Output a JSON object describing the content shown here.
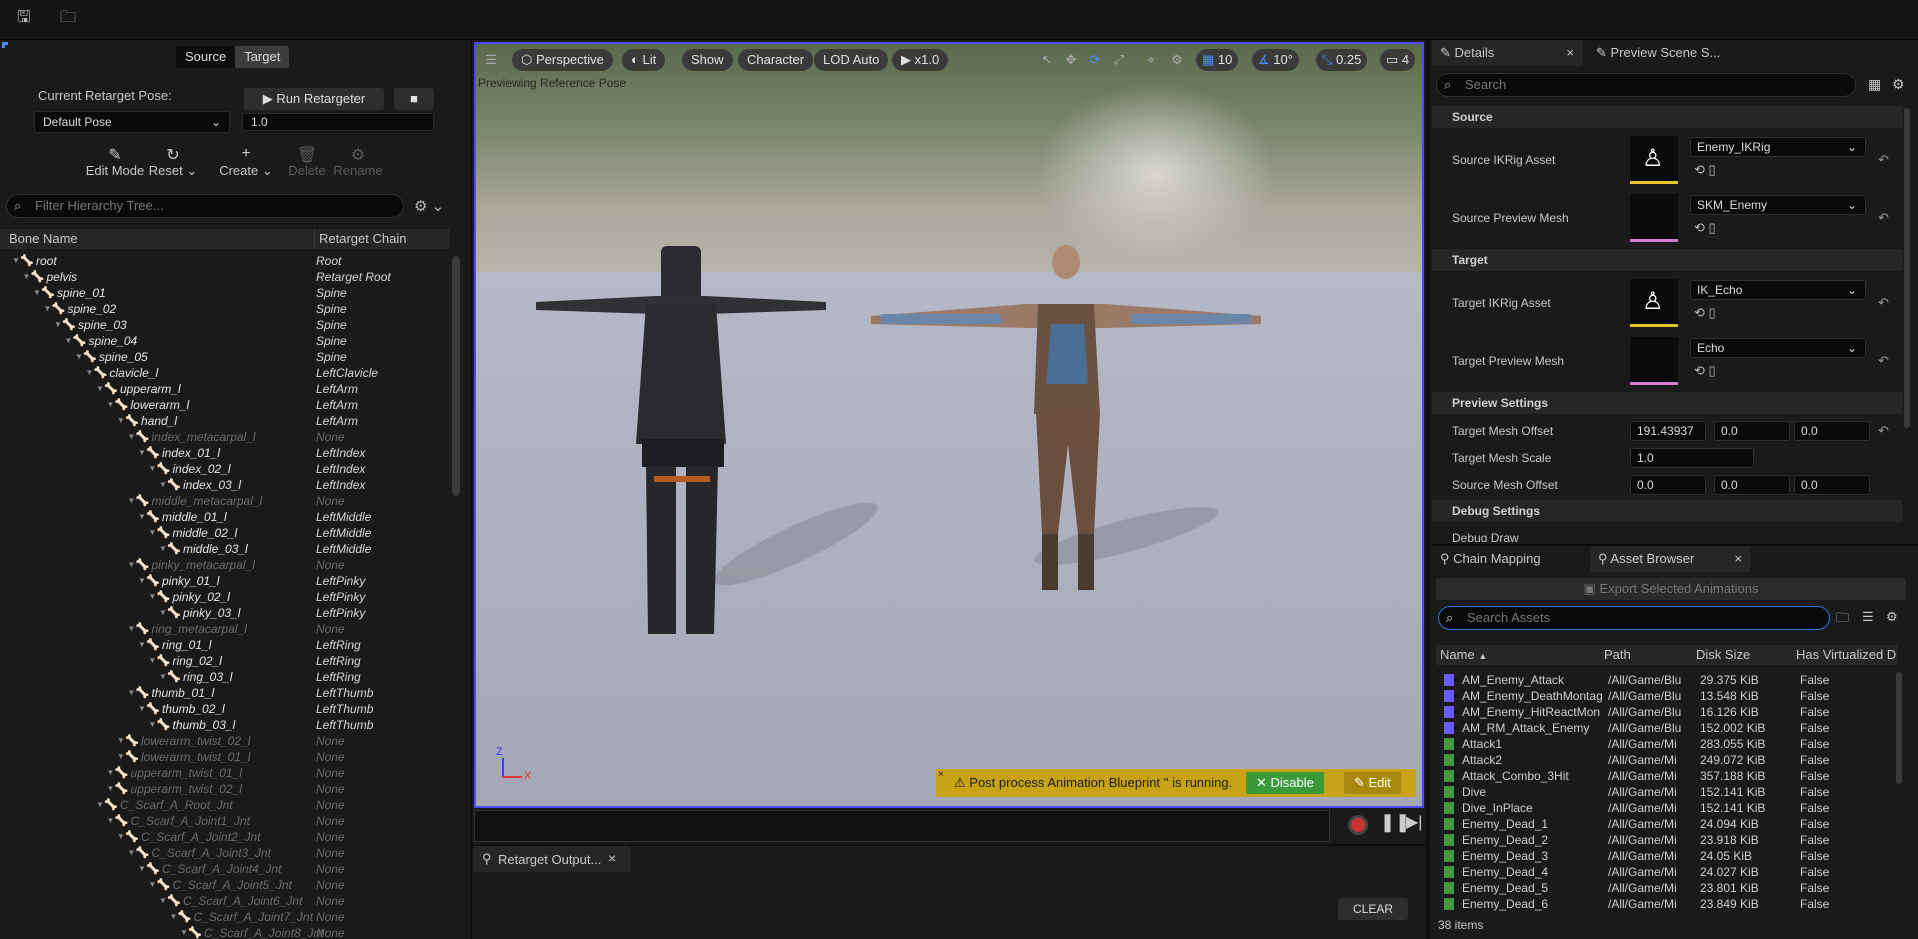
{
  "toolbar": {
    "save_icon": "save-icon",
    "open_icon": "open-asset-icon"
  },
  "left_panel": {
    "source_tab": "Source",
    "target_tab": "Target",
    "current_pose_label": "Current Retarget Pose:",
    "run_button": "Run Retargeter",
    "pose_value": "Default Pose",
    "pose_blend": "1.0",
    "tools": {
      "edit_mode": "Edit Mode",
      "reset": "Reset",
      "create": "Create",
      "delete": "Delete",
      "rename": "Rename"
    },
    "filter_placeholder": "Filter Hierarchy Tree...",
    "col_bone": "Bone Name",
    "col_chain": "Retarget Chain",
    "bones": [
      {
        "name": "root",
        "chain": "Root",
        "depth": 0,
        "dim": false
      },
      {
        "name": "pelvis",
        "chain": "Retarget Root",
        "depth": 1,
        "dim": false
      },
      {
        "name": "spine_01",
        "chain": "Spine",
        "depth": 2,
        "dim": false
      },
      {
        "name": "spine_02",
        "chain": "Spine",
        "depth": 3,
        "dim": false
      },
      {
        "name": "spine_03",
        "chain": "Spine",
        "depth": 4,
        "dim": false
      },
      {
        "name": "spine_04",
        "chain": "Spine",
        "depth": 5,
        "dim": false
      },
      {
        "name": "spine_05",
        "chain": "Spine",
        "depth": 6,
        "dim": false
      },
      {
        "name": "clavicle_l",
        "chain": "LeftClavicle",
        "depth": 7,
        "dim": false
      },
      {
        "name": "upperarm_l",
        "chain": "LeftArm",
        "depth": 8,
        "dim": false
      },
      {
        "name": "lowerarm_l",
        "chain": "LeftArm",
        "depth": 9,
        "dim": false
      },
      {
        "name": "hand_l",
        "chain": "LeftArm",
        "depth": 10,
        "dim": false
      },
      {
        "name": "index_metacarpal_l",
        "chain": "None",
        "depth": 11,
        "dim": true
      },
      {
        "name": "index_01_l",
        "chain": "LeftIndex",
        "depth": 12,
        "dim": false
      },
      {
        "name": "index_02_l",
        "chain": "LeftIndex",
        "depth": 13,
        "dim": false
      },
      {
        "name": "index_03_l",
        "chain": "LeftIndex",
        "depth": 14,
        "dim": false
      },
      {
        "name": "middle_metacarpal_l",
        "chain": "None",
        "depth": 11,
        "dim": true
      },
      {
        "name": "middle_01_l",
        "chain": "LeftMiddle",
        "depth": 12,
        "dim": false
      },
      {
        "name": "middle_02_l",
        "chain": "LeftMiddle",
        "depth": 13,
        "dim": false
      },
      {
        "name": "middle_03_l",
        "chain": "LeftMiddle",
        "depth": 14,
        "dim": false
      },
      {
        "name": "pinky_metacarpal_l",
        "chain": "None",
        "depth": 11,
        "dim": true
      },
      {
        "name": "pinky_01_l",
        "chain": "LeftPinky",
        "depth": 12,
        "dim": false
      },
      {
        "name": "pinky_02_l",
        "chain": "LeftPinky",
        "depth": 13,
        "dim": false
      },
      {
        "name": "pinky_03_l",
        "chain": "LeftPinky",
        "depth": 14,
        "dim": false
      },
      {
        "name": "ring_metacarpal_l",
        "chain": "None",
        "depth": 11,
        "dim": true
      },
      {
        "name": "ring_01_l",
        "chain": "LeftRing",
        "depth": 12,
        "dim": false
      },
      {
        "name": "ring_02_l",
        "chain": "LeftRing",
        "depth": 13,
        "dim": false
      },
      {
        "name": "ring_03_l",
        "chain": "LeftRing",
        "depth": 14,
        "dim": false
      },
      {
        "name": "thumb_01_l",
        "chain": "LeftThumb",
        "depth": 11,
        "dim": false
      },
      {
        "name": "thumb_02_l",
        "chain": "LeftThumb",
        "depth": 12,
        "dim": false
      },
      {
        "name": "thumb_03_l",
        "chain": "LeftThumb",
        "depth": 13,
        "dim": false
      },
      {
        "name": "lowerarm_twist_02_l",
        "chain": "None",
        "depth": 10,
        "dim": true
      },
      {
        "name": "lowerarm_twist_01_l",
        "chain": "None",
        "depth": 10,
        "dim": true
      },
      {
        "name": "upperarm_twist_01_l",
        "chain": "None",
        "depth": 9,
        "dim": true
      },
      {
        "name": "upperarm_twist_02_l",
        "chain": "None",
        "depth": 9,
        "dim": true
      },
      {
        "name": "C_Scarf_A_Root_Jnt",
        "chain": "None",
        "depth": 8,
        "dim": true
      },
      {
        "name": "C_Scarf_A_Joint1_Jnt",
        "chain": "None",
        "depth": 9,
        "dim": true
      },
      {
        "name": "C_Scarf_A_Joint2_Jnt",
        "chain": "None",
        "depth": 10,
        "dim": true
      },
      {
        "name": "C_Scarf_A_Joint3_Jnt",
        "chain": "None",
        "depth": 11,
        "dim": true
      },
      {
        "name": "C_Scarf_A_Joint4_Jnt",
        "chain": "None",
        "depth": 12,
        "dim": true
      },
      {
        "name": "C_Scarf_A_Joint5_Jnt",
        "chain": "None",
        "depth": 13,
        "dim": true
      },
      {
        "name": "C_Scarf_A_Joint6_Jnt",
        "chain": "None",
        "depth": 14,
        "dim": true
      },
      {
        "name": "C_Scarf_A_Joint7_Jnt",
        "chain": "None",
        "depth": 15,
        "dim": true
      },
      {
        "name": "C_Scarf_A_Joint8_Jnt",
        "chain": "None",
        "depth": 16,
        "dim": true
      }
    ]
  },
  "viewport": {
    "perspective": "Perspective",
    "lit": "Lit",
    "show": "Show",
    "character": "Character",
    "lod": "LOD Auto",
    "speed": "x1.0",
    "grid_snap": "10",
    "rot_snap": "10°",
    "scale_snap": "0.25",
    "cam_speed": "4",
    "preview_text": "Previewing Reference Pose",
    "notice": "Post process Animation Blueprint '' is running.",
    "disable": "Disable",
    "edit": "Edit",
    "axis_x": "X",
    "axis_z": "Z"
  },
  "output": {
    "tab": "Retarget Output...",
    "clear": "CLEAR"
  },
  "details": {
    "tab": "Details",
    "tab2": "Preview Scene S...",
    "search_placeholder": "Search",
    "source_section": "Source",
    "source_ikrig_label": "Source IKRig Asset",
    "source_ikrig": "Enemy_IKRig",
    "source_mesh_label": "Source Preview Mesh",
    "source_mesh": "SKM_Enemy",
    "target_section": "Target",
    "target_ikrig_label": "Target IKRig Asset",
    "target_ikrig": "IK_Echo",
    "target_mesh_label": "Target Preview Mesh",
    "target_mesh": "Echo",
    "preview_section": "Preview Settings",
    "mesh_offset_label": "Target Mesh Offset",
    "mesh_offset": [
      "191.43937",
      "0.0",
      "0.0"
    ],
    "mesh_scale_label": "Target Mesh Scale",
    "mesh_scale": "1.0",
    "src_offset_label": "Source Mesh Offset",
    "src_offset": [
      "0.0",
      "0.0",
      "0.0"
    ],
    "debug_section": "Debug Settings",
    "debug_draw": "Debug Draw"
  },
  "assets": {
    "tab1": "Chain Mapping",
    "tab2": "Asset Browser",
    "export": "Export Selected Animations",
    "search_placeholder": "Search Assets",
    "cols": [
      "Name",
      "Path",
      "Disk Size",
      "Has Virtualized D"
    ],
    "rows": [
      {
        "name": "AM_Enemy_Attack",
        "path": "/All/Game/Blu",
        "size": "29.375 KiB",
        "virt": "False",
        "kind": "montage"
      },
      {
        "name": "AM_Enemy_DeathMontag",
        "path": "/All/Game/Blu",
        "size": "13.548 KiB",
        "virt": "False",
        "kind": "montage"
      },
      {
        "name": "AM_Enemy_HitReactMon",
        "path": "/All/Game/Blu",
        "size": "16.126 KiB",
        "virt": "False",
        "kind": "montage"
      },
      {
        "name": "AM_RM_Attack_Enemy",
        "path": "/All/Game/Blu",
        "size": "152.002 KiB",
        "virt": "False",
        "kind": "montage"
      },
      {
        "name": "Attack1",
        "path": "/All/Game/Mi",
        "size": "283.055 KiB",
        "virt": "False",
        "kind": "anim"
      },
      {
        "name": "Attack2",
        "path": "/All/Game/Mi",
        "size": "249.072 KiB",
        "virt": "False",
        "kind": "anim"
      },
      {
        "name": "Attack_Combo_3Hit",
        "path": "/All/Game/Mi",
        "size": "357.188 KiB",
        "virt": "False",
        "kind": "anim"
      },
      {
        "name": "Dive",
        "path": "/All/Game/Mi",
        "size": "152.141 KiB",
        "virt": "False",
        "kind": "anim"
      },
      {
        "name": "Dive_InPlace",
        "path": "/All/Game/Mi",
        "size": "152.141 KiB",
        "virt": "False",
        "kind": "anim"
      },
      {
        "name": "Enemy_Dead_1",
        "path": "/All/Game/Mi",
        "size": "24.094 KiB",
        "virt": "False",
        "kind": "anim"
      },
      {
        "name": "Enemy_Dead_2",
        "path": "/All/Game/Mi",
        "size": "23.918 KiB",
        "virt": "False",
        "kind": "anim"
      },
      {
        "name": "Enemy_Dead_3",
        "path": "/All/Game/Mi",
        "size": "24.05 KiB",
        "virt": "False",
        "kind": "anim"
      },
      {
        "name": "Enemy_Dead_4",
        "path": "/All/Game/Mi",
        "size": "24.027 KiB",
        "virt": "False",
        "kind": "anim"
      },
      {
        "name": "Enemy_Dead_5",
        "path": "/All/Game/Mi",
        "size": "23.801 KiB",
        "virt": "False",
        "kind": "anim"
      },
      {
        "name": "Enemy_Dead_6",
        "path": "/All/Game/Mi",
        "size": "23.849 KiB",
        "virt": "False",
        "kind": "anim"
      }
    ],
    "count": "38 items"
  },
  "colors": {
    "accent": "#4a4aff",
    "montage": "#6a5cff",
    "anim": "#3f9a3f",
    "notice": "#c8a318"
  }
}
